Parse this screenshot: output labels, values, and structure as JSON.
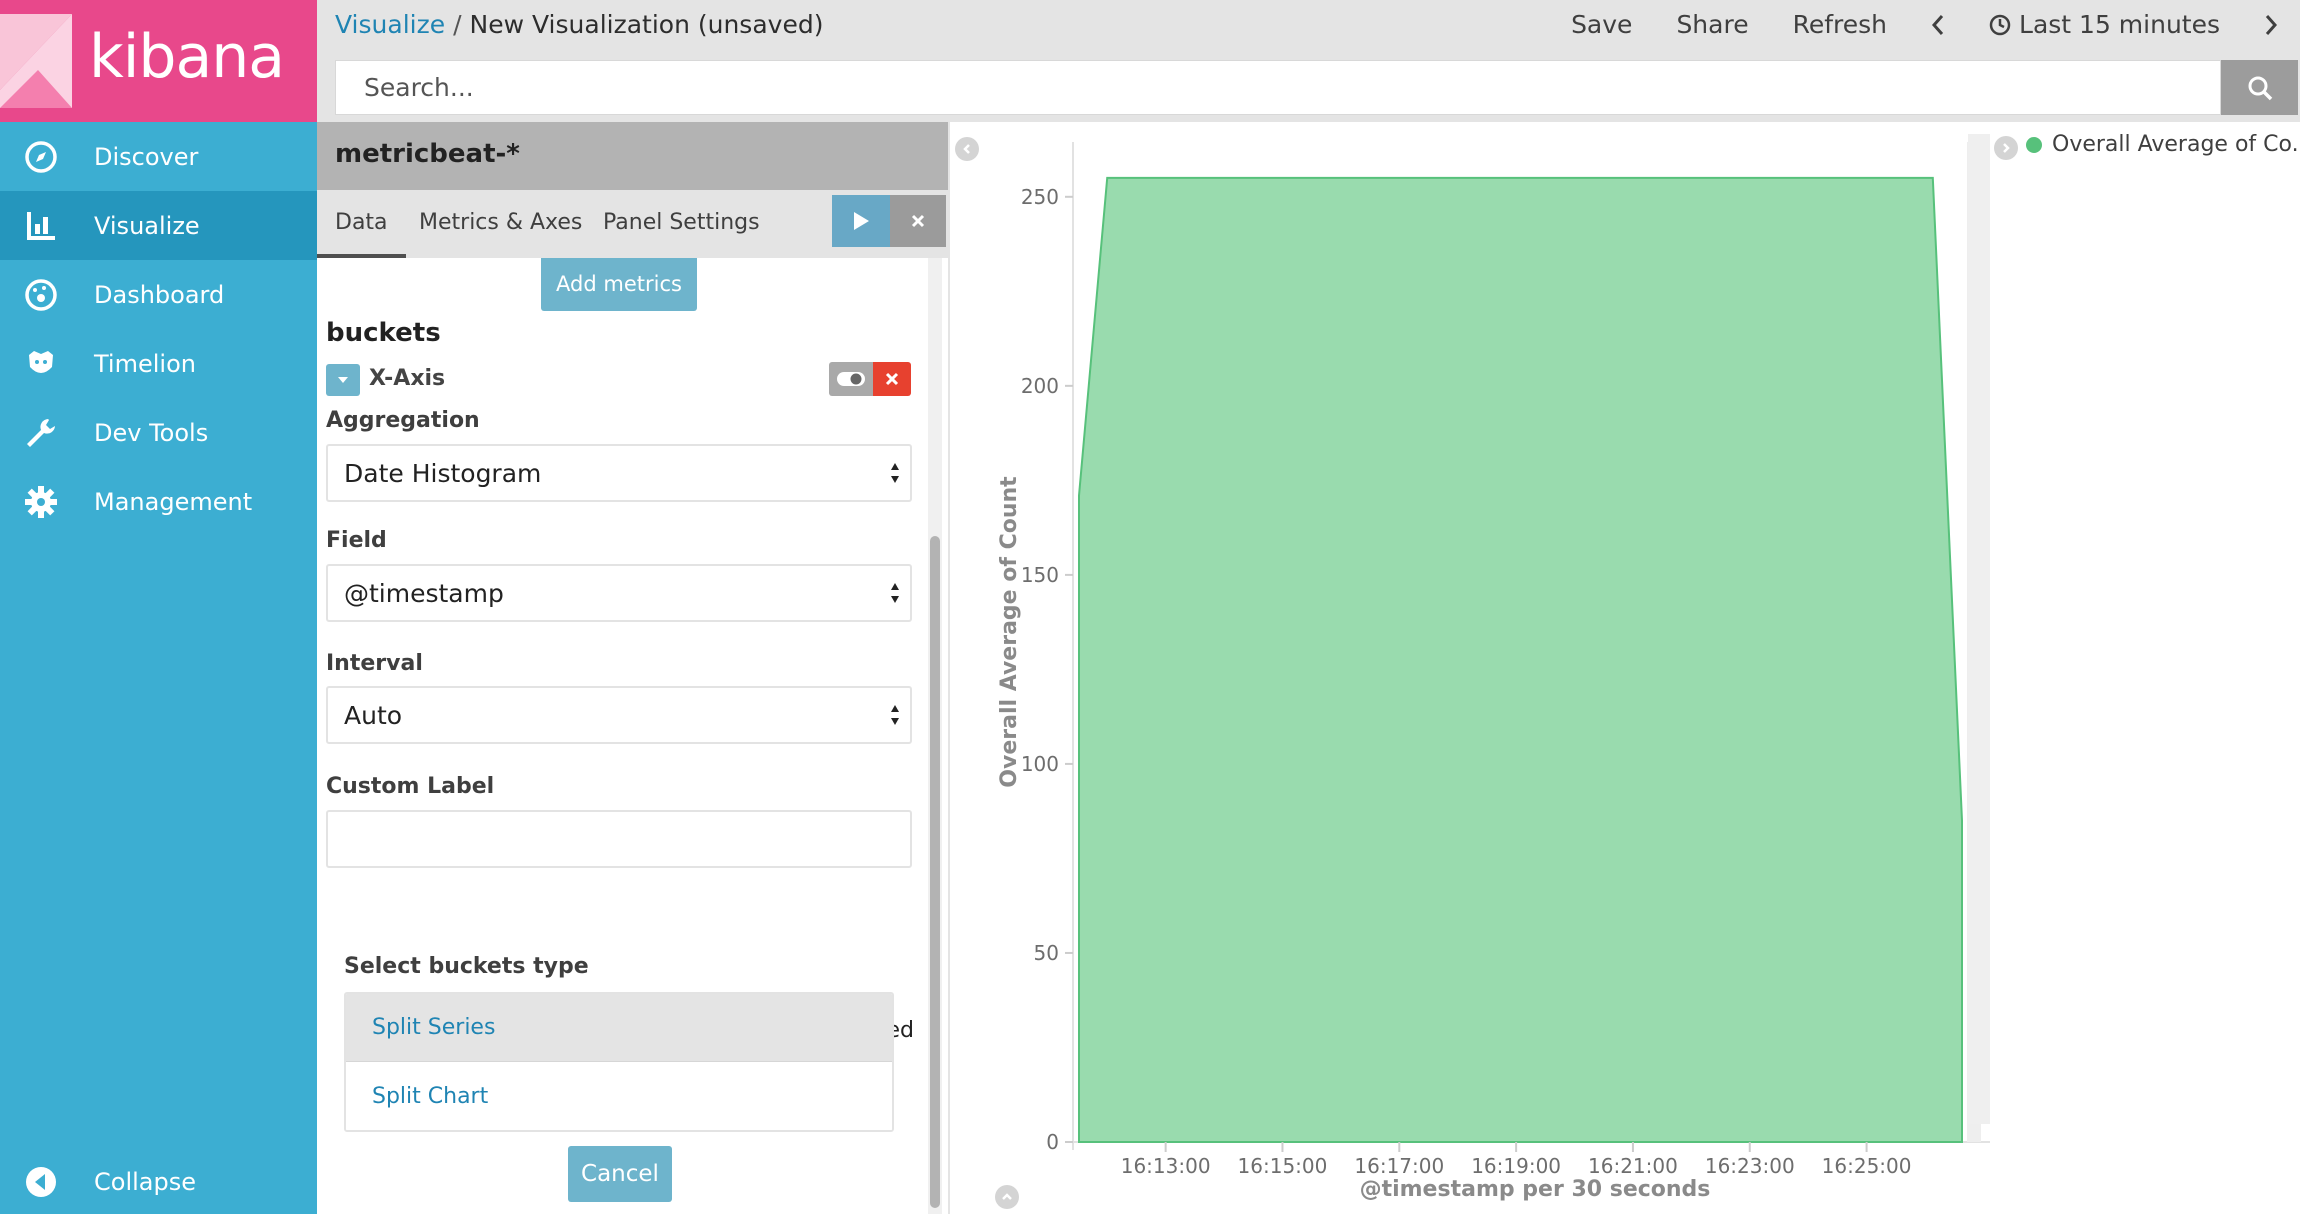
{
  "app": {
    "logo_text": "kibana",
    "brand_color": "#e8488b",
    "sidebar_color": "#3caed2"
  },
  "sidebar": {
    "items": [
      {
        "label": "Discover",
        "icon": "compass-icon"
      },
      {
        "label": "Visualize",
        "icon": "bar-chart-icon",
        "active": true
      },
      {
        "label": "Dashboard",
        "icon": "dashboard-icon"
      },
      {
        "label": "Timelion",
        "icon": "timelion-icon"
      },
      {
        "label": "Dev Tools",
        "icon": "wrench-icon"
      },
      {
        "label": "Management",
        "icon": "gear-icon"
      }
    ],
    "collapse_label": "Collapse"
  },
  "breadcrumb": {
    "parent": "Visualize",
    "separator": "/",
    "current": "New Visualization (unsaved)"
  },
  "top_actions": {
    "save": "Save",
    "share": "Share",
    "refresh": "Refresh",
    "time_range": "Last 15 minutes"
  },
  "search": {
    "placeholder": "Search..."
  },
  "editor": {
    "index_pattern": "metricbeat-*",
    "tabs": [
      "Data",
      "Metrics & Axes",
      "Panel Settings"
    ],
    "add_metrics": "Add metrics",
    "buckets_title": "buckets",
    "bucket_label": "X-Axis",
    "aggregation_label": "Aggregation",
    "aggregation_value": "Date Histogram",
    "field_label": "Field",
    "field_value": "@timestamp",
    "interval_label": "Interval",
    "interval_value": "Auto",
    "custom_label_label": "Custom Label",
    "custom_label_value": "",
    "advanced": "Advanced",
    "select_bucket_type": "Select buckets type",
    "bucket_types": [
      "Split Series",
      "Split Chart"
    ],
    "cancel": "Cancel"
  },
  "chart_data": {
    "type": "area",
    "xlabel": "@timestamp per 30 seconds",
    "ylabel": "Overall Average of Count",
    "ylim": [
      0,
      260
    ],
    "y_ticks": [
      0,
      50,
      100,
      150,
      200,
      250
    ],
    "x_tick_labels": [
      "16:13:00",
      "16:15:00",
      "16:17:00",
      "16:19:00",
      "16:21:00",
      "16:23:00",
      "16:25:00"
    ],
    "x_ticks_seconds": [
      780,
      900,
      1020,
      1140,
      1260,
      1380,
      1500
    ],
    "x_range_seconds": [
      691,
      1598
    ],
    "points": [
      {
        "t": 691,
        "y": 171
      },
      {
        "t": 720,
        "y": 255
      },
      {
        "t": 1568,
        "y": 255
      },
      {
        "t": 1598,
        "y": 85
      }
    ],
    "series": [
      {
        "name": "Overall Average of Co...",
        "color": "#57c17b"
      }
    ],
    "legend_position": "top-right"
  }
}
